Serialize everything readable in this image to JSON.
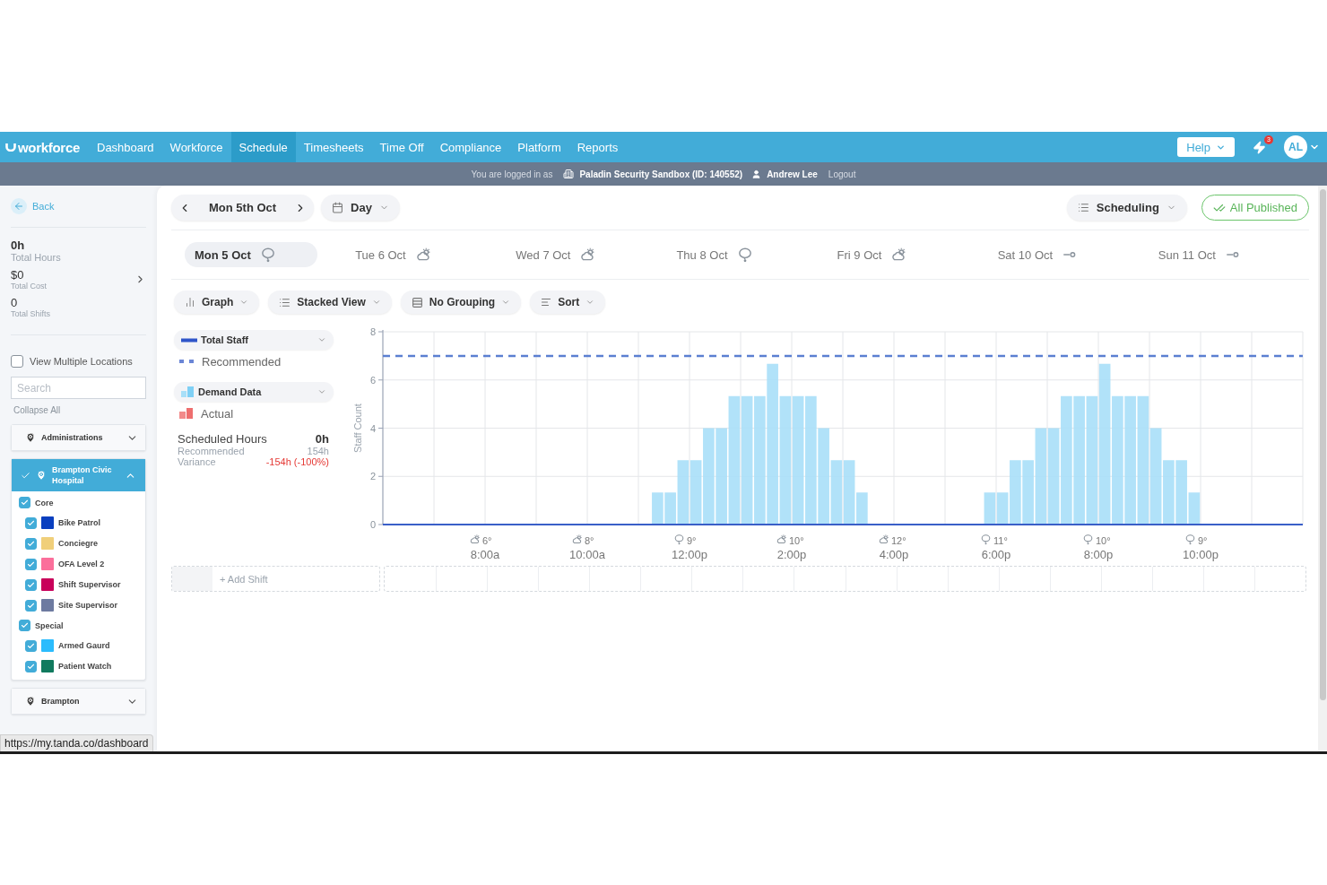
{
  "nav": {
    "logo": "workforce",
    "items": [
      {
        "label": "Dashboard",
        "selected": false
      },
      {
        "label": "Workforce",
        "selected": false
      },
      {
        "label": "Schedule",
        "selected": true
      },
      {
        "label": "Timesheets",
        "selected": false
      },
      {
        "label": "Time Off",
        "selected": false
      },
      {
        "label": "Compliance",
        "selected": false
      },
      {
        "label": "Platform",
        "selected": false
      },
      {
        "label": "Reports",
        "selected": false
      }
    ],
    "help": "Help",
    "notifications": "3",
    "avatar": "AL"
  },
  "session": {
    "prefix": "You are logged in as",
    "org": "Paladin Security Sandbox (ID: 140552)",
    "user": "Andrew Lee",
    "logout": "Logout"
  },
  "sidebar": {
    "back": "Back",
    "stats": [
      {
        "value": "0h",
        "label": "Total Hours",
        "kind": "primary"
      },
      {
        "value": "$0",
        "label": "Total Cost",
        "kind": "link"
      },
      {
        "value": "0",
        "label": "Total Shifts",
        "kind": "secondary"
      }
    ],
    "multi_locations": {
      "label": "View Multiple Locations",
      "checked": false
    },
    "search": {
      "placeholder": "Search"
    },
    "collapse_all": "Collapse All",
    "locations": [
      {
        "name": "Administrations",
        "checked": false,
        "expanded": false
      },
      {
        "name": "Brampton Civic Hospital",
        "checked": true,
        "expanded": true,
        "children": [
          {
            "label": "Core",
            "checked": true,
            "children": [
              {
                "label": "Bike Patrol",
                "checked": true,
                "color": "#0a3fbf"
              },
              {
                "label": "Conciegre",
                "checked": true,
                "color": "#f0cf7a"
              },
              {
                "label": "OFA Level 2",
                "checked": true,
                "color": "#fb6f9b"
              },
              {
                "label": "Shift Supervisor",
                "checked": true,
                "color": "#c8005a"
              },
              {
                "label": "Site Supervisor",
                "checked": true,
                "color": "#6d7aa0"
              }
            ]
          },
          {
            "label": "Special",
            "checked": true,
            "children": [
              {
                "label": "Armed Gaurd",
                "checked": true,
                "color": "#2bbcfd"
              },
              {
                "label": "Patient Watch",
                "checked": true,
                "color": "#117a5e"
              }
            ]
          }
        ]
      },
      {
        "name": "Brampton",
        "checked": false,
        "expanded": false
      }
    ]
  },
  "toolbar": {
    "date": "Mon 5th Oct",
    "view": "Day",
    "mode": "Scheduling",
    "publish": "All Published"
  },
  "days": [
    {
      "label": "Mon 5 Oct",
      "kind": "cloudy",
      "selected": true
    },
    {
      "label": "Tue 6 Oct",
      "kind": "partly_cloudy",
      "selected": false
    },
    {
      "label": "Wed 7 Oct",
      "kind": "partly_cloudy",
      "selected": false
    },
    {
      "label": "Thu 8 Oct",
      "kind": "cloudy",
      "selected": false
    },
    {
      "label": "Fri 9 Oct",
      "kind": "partly_cloudy",
      "selected": false
    },
    {
      "label": "Sat 10 Oct",
      "kind": "breeze",
      "selected": false
    },
    {
      "label": "Sun 11 Oct",
      "kind": "breeze",
      "selected": false
    }
  ],
  "view_options": [
    {
      "label": "Graph",
      "kind": "graph"
    },
    {
      "label": "Stacked View",
      "kind": "list"
    },
    {
      "label": "No Grouping",
      "kind": "group"
    },
    {
      "label": "Sort",
      "kind": "sort"
    }
  ],
  "legend": [
    {
      "label": "Total Staff",
      "kind": "line",
      "dropdown": true
    },
    {
      "label": "Recommended",
      "kind": "dashed",
      "dropdown": false
    },
    {
      "label": "Demand Data",
      "kind": "bars",
      "dropdown": true
    },
    {
      "label": "Actual",
      "kind": "red_bars",
      "dropdown": false
    }
  ],
  "hours": [
    {
      "label": "Scheduled Hours",
      "value": "0h",
      "kind": "total"
    },
    {
      "label": "Recommended",
      "value": "154h",
      "kind": "sub"
    },
    {
      "label": "Variance",
      "value": "-154h (-100%)",
      "kind": "negative"
    }
  ],
  "chart": {
    "chart_data": {
      "type": "bar",
      "ylabel": "Staff Count",
      "ylim": [
        0,
        8
      ],
      "xlim": [
        6,
        24
      ],
      "yticks": [
        0,
        2,
        4,
        6,
        8
      ],
      "grid": true,
      "x": [
        11.375,
        11.625,
        11.875,
        12.125,
        12.375,
        12.625,
        12.875,
        13.125,
        13.375,
        13.625,
        13.875,
        14.125,
        14.375,
        14.625,
        14.875,
        15.125,
        15.375,
        17.875,
        18.125,
        18.375,
        18.625,
        18.875,
        19.125,
        19.375,
        19.625,
        19.875,
        20.125,
        20.375,
        20.625,
        20.875,
        21.125,
        21.375,
        21.625,
        21.875
      ],
      "xticks": [
        {
          "value": 8,
          "label": "8:00a"
        },
        {
          "value": 10,
          "label": "10:00a"
        },
        {
          "value": 12,
          "label": "12:00p"
        },
        {
          "value": 14,
          "label": "2:00p"
        },
        {
          "value": 16,
          "label": "4:00p"
        },
        {
          "value": 18,
          "label": "6:00p"
        },
        {
          "value": 20,
          "label": "8:00p"
        },
        {
          "value": 22,
          "label": "10:00p"
        }
      ],
      "series": [
        {
          "color": "#a8dff8",
          "values": [
            1.33,
            1.33,
            2.67,
            2.67,
            4,
            4,
            5.33,
            5.33,
            5.33,
            6.67,
            5.33,
            5.33,
            5.33,
            4,
            2.67,
            2.67,
            1.33,
            1.33,
            1.33,
            2.67,
            2.67,
            4,
            4,
            5.33,
            5.33,
            5.33,
            6.67,
            5.33,
            5.33,
            5.33,
            4,
            2.67,
            2.67,
            1.33
          ]
        }
      ],
      "ref_lines": [
        {
          "axis": "y",
          "value": 7,
          "color": "#5b7fd1"
        }
      ]
    },
    "tick_weather": [
      {
        "kind": "partly_cloudy",
        "temp": "6°"
      },
      {
        "kind": "partly_cloudy",
        "temp": "8°"
      },
      {
        "kind": "cloudy",
        "temp": "9°"
      },
      {
        "kind": "partly_cloudy",
        "temp": "10°"
      },
      {
        "kind": "partly_cloudy",
        "temp": "12°"
      },
      {
        "kind": "cloudy",
        "temp": "11°"
      },
      {
        "kind": "cloudy",
        "temp": "10°"
      },
      {
        "kind": "cloudy",
        "temp": "9°"
      }
    ]
  },
  "add_shift": "+ Add Shift",
  "status_url": "https://my.tanda.co/dashboard"
}
